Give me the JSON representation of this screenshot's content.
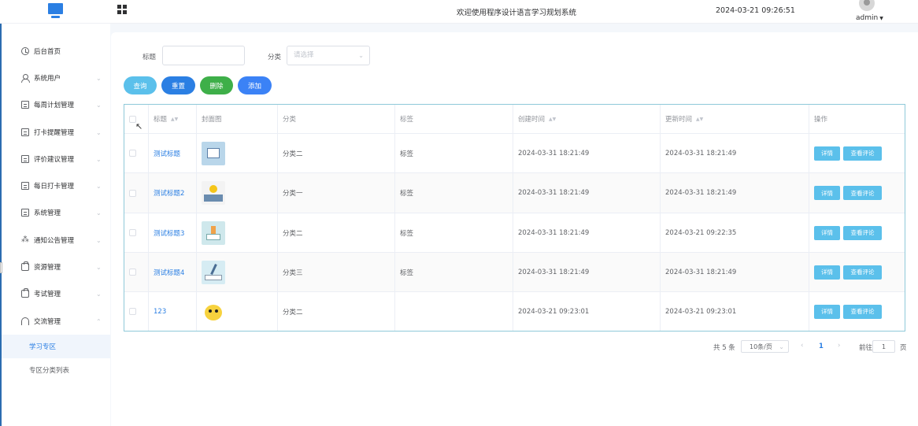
{
  "header": {
    "welcome": "欢迎使用程序设计语言学习规划系统",
    "datetime": "2024-03-21 09:26:51",
    "user": "admin"
  },
  "sidebar": {
    "items": [
      {
        "label": "后台首页",
        "icon": "clock-icon"
      },
      {
        "label": "系统用户",
        "icon": "user-icon"
      },
      {
        "label": "每周计划管理",
        "icon": "box-icon"
      },
      {
        "label": "打卡提醒管理",
        "icon": "box-icon"
      },
      {
        "label": "评价建议管理",
        "icon": "box-icon"
      },
      {
        "label": "每日打卡管理",
        "icon": "box-icon"
      },
      {
        "label": "系统管理",
        "icon": "box-icon"
      },
      {
        "label": "通知公告管理",
        "icon": "star-icon"
      },
      {
        "label": "资源管理",
        "icon": "bag-icon"
      },
      {
        "label": "考试管理",
        "icon": "bag-icon"
      },
      {
        "label": "交流管理",
        "icon": "headset-icon"
      }
    ],
    "sub_items": [
      {
        "label": "学习专区"
      },
      {
        "label": "专区分类列表"
      }
    ]
  },
  "filters": {
    "title_label": "标题",
    "title_value": "",
    "category_label": "分类",
    "category_placeholder": "请选择"
  },
  "buttons": {
    "query": "查询",
    "reset": "重置",
    "delete": "删除",
    "add": "添加"
  },
  "colors": {
    "query": "#5bc0eb",
    "reset": "#2b7fe3",
    "delete": "#3eaf49",
    "add": "#3b82f6"
  },
  "table": {
    "headers": [
      "标题",
      "封面图",
      "分类",
      "标签",
      "创建时间",
      "更新时间",
      "操作"
    ],
    "rows": [
      {
        "title": "测试标题",
        "category": "分类二",
        "tag": "标签",
        "created": "2024-03-31 18:21:49",
        "updated": "2024-03-31 18:21:49",
        "detail": "详情",
        "comments": "查看评论"
      },
      {
        "title": "测试标题2",
        "category": "分类一",
        "tag": "标签",
        "created": "2024-03-31 18:21:49",
        "updated": "2024-03-31 18:21:49",
        "detail": "详情",
        "comments": "查看评论"
      },
      {
        "title": "测试标题3",
        "category": "分类二",
        "tag": "标签",
        "created": "2024-03-31 18:21:49",
        "updated": "2024-03-21 09:22:35",
        "detail": "详情",
        "comments": "查看评论"
      },
      {
        "title": "测试标题4",
        "category": "分类三",
        "tag": "标签",
        "created": "2024-03-31 18:21:49",
        "updated": "2024-03-31 18:21:49",
        "detail": "详情",
        "comments": "查看评论"
      },
      {
        "title": "123",
        "category": "分类二",
        "tag": "",
        "created": "2024-03-21 09:23:01",
        "updated": "2024-03-21 09:23:01",
        "detail": "详情",
        "comments": "查看评论"
      }
    ]
  },
  "pagination": {
    "total": "共 5 条",
    "page_size": "10条/页",
    "current_page": "1",
    "goto_label": "前往",
    "goto_value": "1",
    "page_unit": "页"
  }
}
